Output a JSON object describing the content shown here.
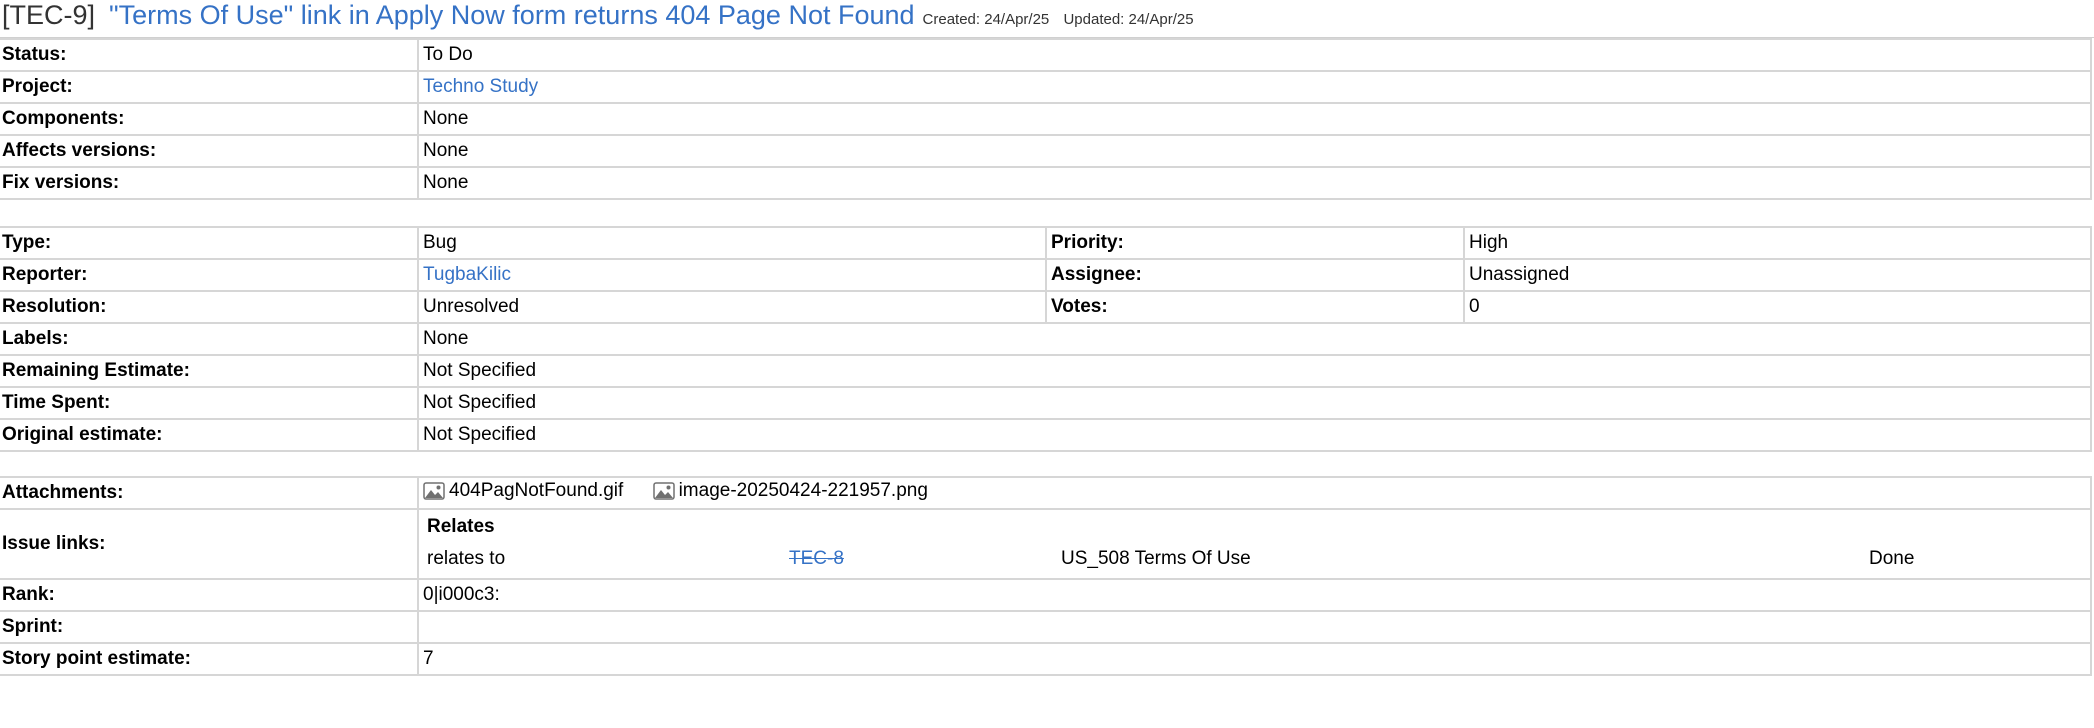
{
  "header": {
    "key": "[TEC-9]",
    "title": "\"Terms Of Use\" link in Apply Now form returns 404 Page Not Found",
    "created": "Created: 24/Apr/25",
    "updated": "Updated: 24/Apr/25"
  },
  "section1": {
    "status": {
      "label": "Status:",
      "value": "To Do"
    },
    "project": {
      "label": "Project:",
      "value": "Techno Study"
    },
    "components": {
      "label": "Components:",
      "value": "None"
    },
    "affects_versions": {
      "label": "Affects versions:",
      "value": "None"
    },
    "fix_versions": {
      "label": "Fix versions:",
      "value": "None"
    }
  },
  "section2": {
    "type": {
      "label": "Type:",
      "value": "Bug"
    },
    "priority": {
      "label": "Priority:",
      "value": "High"
    },
    "reporter": {
      "label": "Reporter:",
      "value": "TugbaKilic"
    },
    "assignee": {
      "label": "Assignee:",
      "value": "Unassigned"
    },
    "resolution": {
      "label": "Resolution:",
      "value": "Unresolved"
    },
    "votes": {
      "label": "Votes:",
      "value": "0"
    },
    "labels": {
      "label": "Labels:",
      "value": "None"
    },
    "remaining_estimate": {
      "label": "Remaining Estimate:",
      "value": "Not Specified"
    },
    "time_spent": {
      "label": "Time Spent:",
      "value": "Not Specified"
    },
    "original_estimate": {
      "label": "Original estimate:",
      "value": "Not Specified"
    }
  },
  "section3": {
    "attachments": {
      "label": "Attachments:",
      "files": [
        "404PagNotFound.gif",
        "image-20250424-221957.png"
      ]
    },
    "issue_links": {
      "label": "Issue links:",
      "group": "Relates",
      "link": {
        "relation": "relates to",
        "key": "TEC-8",
        "summary": "US_508 Terms Of Use",
        "status": "Done"
      }
    },
    "rank": {
      "label": "Rank:",
      "value": "0|i000c3:"
    },
    "sprint": {
      "label": "Sprint:",
      "value": ""
    },
    "story_points": {
      "label": "Story point estimate:",
      "value": "7"
    }
  },
  "icons": {
    "attachment": "image-icon"
  },
  "colors": {
    "link": "#3572c6",
    "border": "#d6d6d6"
  }
}
